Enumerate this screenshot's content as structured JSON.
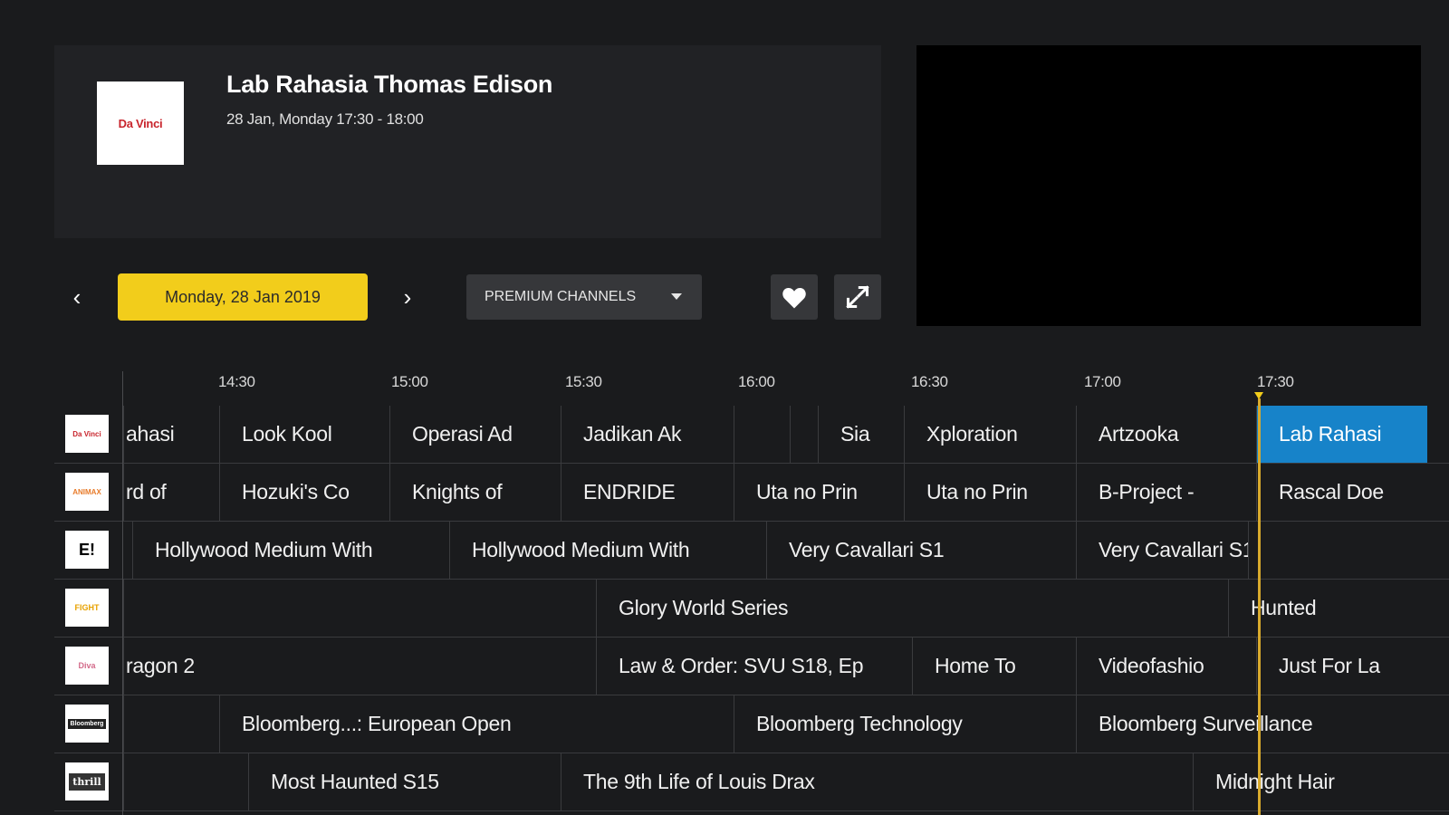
{
  "info": {
    "channel_logo_text": "Da Vinci",
    "title": "Lab Rahasia Thomas Edison",
    "time": "28 Jan, Monday  17:30 - 18:00"
  },
  "controls": {
    "prev_icon": "‹",
    "next_icon": "›",
    "date_label": "Monday, 28 Jan 2019",
    "category_label": "PREMIUM CHANNELS",
    "favorite_icon": "heart-icon",
    "fullscreen_icon": "expand-icon"
  },
  "colors": {
    "accent_yellow": "#f2cd1b",
    "active_blue": "#1783c9",
    "now_line": "#d8aa2d"
  },
  "timeline": {
    "ticks": [
      "14:30",
      "15:00",
      "15:30",
      "16:00",
      "16:30",
      "17:00",
      "17:30"
    ]
  },
  "channels": [
    {
      "logo": "Da Vinci",
      "programs": [
        "ahasi",
        "Look Kool",
        "Operasi Ad",
        "Jadikan Ak",
        "",
        "",
        "Sia",
        "Xploration",
        "Artzooka",
        "Lab Rahasi"
      ]
    },
    {
      "logo": "ANIMAX",
      "programs": [
        "rd of",
        "Hozuki's Co",
        "Knights of",
        "ENDRIDE",
        "Uta no Prin",
        "Uta no Prin",
        "B-Project -",
        "Rascal Doe"
      ]
    },
    {
      "logo": "E!",
      "programs": [
        "Hollywood Medium With",
        "Hollywood Medium With",
        "Very Cavallari S1",
        "Very Cavallari S1",
        ""
      ]
    },
    {
      "logo": "FIGHT",
      "programs": [
        "",
        "Glory World Series",
        "Hunted"
      ]
    },
    {
      "logo": "Diva",
      "programs": [
        "ragon 2",
        "Law & Order: SVU S18, Ep",
        "Home To",
        "Videofashio",
        "Just For La"
      ]
    },
    {
      "logo": "Bloomberg",
      "programs": [
        "",
        "Bloomberg...: European Open",
        "Bloomberg Technology",
        "Bloomberg Surveillance"
      ]
    },
    {
      "logo": "thrill",
      "programs": [
        "",
        "Most Haunted S15",
        "The 9th Life of Louis Drax",
        "Midnight Hair"
      ]
    }
  ]
}
